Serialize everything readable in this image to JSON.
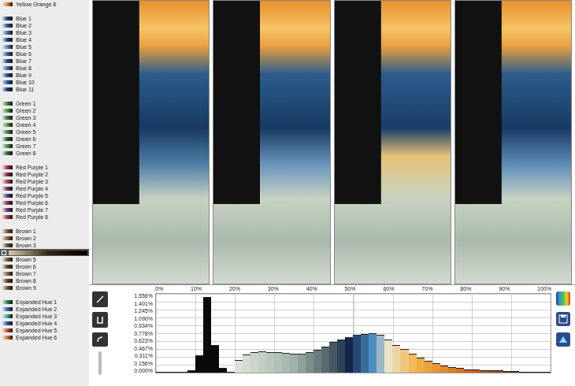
{
  "colormaps": [
    {
      "items": [
        {
          "label": "Yellow Orange 8",
          "color": "#e0902c",
          "selected": false
        }
      ]
    },
    {
      "items": [
        {
          "label": "Blue 1",
          "color": "#1c3f7a",
          "selected": false
        },
        {
          "label": "Blue 2",
          "color": "#2a5a9a",
          "selected": false
        },
        {
          "label": "Blue 3",
          "color": "#3f76b4",
          "selected": false
        },
        {
          "label": "Blue 4",
          "color": "#21487e",
          "selected": false
        },
        {
          "label": "Blue 5",
          "color": "#5d8fc0",
          "selected": false
        },
        {
          "label": "Blue 6",
          "color": "#2f6aa8",
          "selected": false
        },
        {
          "label": "Blue 7",
          "color": "#1a4f8f",
          "selected": false
        },
        {
          "label": "Blue 8",
          "color": "#3a6fae",
          "selected": false
        },
        {
          "label": "Blue 9",
          "color": "#244f8c",
          "selected": false
        },
        {
          "label": "Blue 10",
          "color": "#2e5fa0",
          "selected": false
        },
        {
          "label": "Blue 11",
          "color": "#1b3c73",
          "selected": false
        }
      ]
    },
    {
      "items": [
        {
          "label": "Green 1",
          "color": "#3a8a3a",
          "selected": false
        },
        {
          "label": "Green 2",
          "color": "#4e9a3c",
          "selected": false
        },
        {
          "label": "Green 3",
          "color": "#2f7a40",
          "selected": false
        },
        {
          "label": "Green 4",
          "color": "#5aa04a",
          "selected": false
        },
        {
          "label": "Green 5",
          "color": "#3c8c52",
          "selected": false
        },
        {
          "label": "Green 6",
          "color": "#1e5a2a",
          "selected": false
        },
        {
          "label": "Green 7",
          "color": "#4a9048",
          "selected": false
        },
        {
          "label": "Green 8",
          "color": "#2a6e34",
          "selected": false
        }
      ]
    },
    {
      "items": [
        {
          "label": "Red Purple 1",
          "color": "#a83246",
          "selected": false
        },
        {
          "label": "Red Purple 2",
          "color": "#8c2a5a",
          "selected": false
        },
        {
          "label": "Red Purple 3",
          "color": "#b0405a",
          "selected": false
        },
        {
          "label": "Red Purple 4",
          "color": "#7a2c6a",
          "selected": false
        },
        {
          "label": "Red Purple 5",
          "color": "#5a3c8a",
          "selected": false
        },
        {
          "label": "Red Purple 6",
          "color": "#9a3050",
          "selected": false
        },
        {
          "label": "Red Purple 7",
          "color": "#6a3a7a",
          "selected": false
        },
        {
          "label": "Red Purple 8",
          "color": "#a23a4e",
          "selected": false
        }
      ]
    },
    {
      "items": [
        {
          "label": "Brown 1",
          "color": "#7a5a3a",
          "selected": false
        },
        {
          "label": "Brown 2",
          "color": "#8a6440",
          "selected": false
        },
        {
          "label": "Brown 3",
          "color": "#6e4e30",
          "selected": false
        },
        {
          "color": "#3a2414",
          "selected": true
        },
        {
          "label": "Brown 5",
          "color": "#80603e",
          "selected": false
        },
        {
          "label": "Brown 6",
          "color": "#6a4a2c",
          "selected": false
        },
        {
          "label": "Brown 7",
          "color": "#8c6a48",
          "selected": false
        },
        {
          "label": "Brown 8",
          "color": "#5e4228",
          "selected": false
        },
        {
          "label": "Brown 9",
          "color": "#7a5836",
          "selected": false
        }
      ]
    },
    {
      "items": [
        {
          "label": "Expanded Hue 1",
          "color": "#2a8a5a",
          "selected": false
        },
        {
          "label": "Expanded Hue 2",
          "color": "#3a6ab0",
          "selected": false
        },
        {
          "label": "Expanded Hue 3",
          "color": "#4aa0a0",
          "selected": false
        },
        {
          "label": "Expanded Hue 4",
          "color": "#2c5a9a",
          "selected": false
        },
        {
          "label": "Expanded Hue 5",
          "color": "#d8502a",
          "selected": false
        },
        {
          "label": "Expanded Hue 6",
          "color": "#e07a2a",
          "selected": false
        }
      ]
    }
  ],
  "histogram": {
    "x_ticks": [
      "0%",
      "10%",
      "20%",
      "30%",
      "40%",
      "50%",
      "60%",
      "70%",
      "80%",
      "90%",
      "100%"
    ],
    "y_ticks": [
      "1.556%",
      "1.401%",
      "1.245%",
      "1.090%",
      "0.934%",
      "0.778%",
      "0.623%",
      "0.467%",
      "0.311%",
      "0.156%",
      "0.000%"
    ],
    "y_max": 1.556,
    "values": [
      0,
      0,
      0,
      0.01,
      0.05,
      0.35,
      1.5,
      0.55,
      0.1,
      0.02,
      0.25,
      0.36,
      0.4,
      0.42,
      0.41,
      0.4,
      0.39,
      0.38,
      0.38,
      0.4,
      0.45,
      0.52,
      0.6,
      0.66,
      0.7,
      0.74,
      0.76,
      0.78,
      0.74,
      0.66,
      0.55,
      0.46,
      0.38,
      0.3,
      0.24,
      0.18,
      0.14,
      0.11,
      0.09,
      0.07,
      0.06,
      0.05,
      0.04,
      0.04,
      0.03,
      0.03,
      0.02,
      0.02,
      0.01,
      0.01
    ]
  }
}
